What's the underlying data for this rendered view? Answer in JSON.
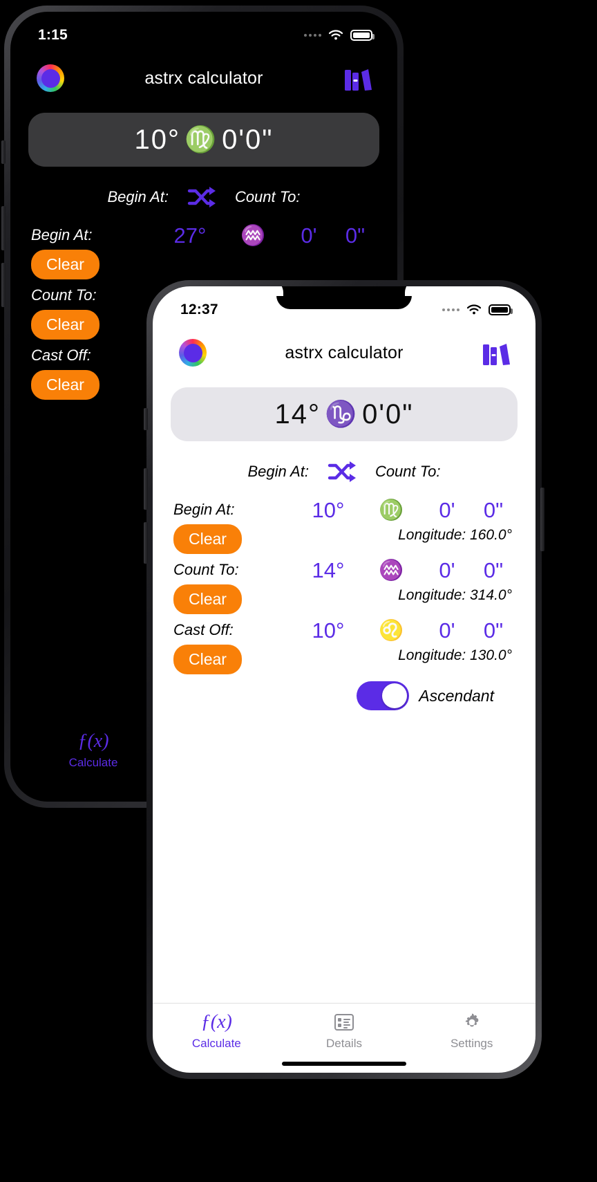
{
  "back_phone": {
    "status": {
      "time": "1:15",
      "wifi_icon": "wifi-icon",
      "battery_icon": "battery-icon",
      "signal_dots": "signal-dots-icon"
    },
    "header": {
      "logo_icon": "color-wheel-icon",
      "title": "astrx calculator",
      "library_icon": "books-icon"
    },
    "result": {
      "degrees": "10°",
      "sign_glyph": "♍",
      "sign_name": "Virgo",
      "minutes": "0'",
      "seconds": "0\""
    },
    "swap": {
      "left_label": "Begin At:",
      "icon": "shuffle-swap-icon",
      "right_label": "Count To:"
    },
    "rows": [
      {
        "label": "Begin At:",
        "clear_label": "Clear",
        "degrees": "27°",
        "sign_glyph": "♒",
        "sign_name": "Aquarius",
        "minutes": "0'",
        "seconds": "0\""
      },
      {
        "label": "Count To:",
        "clear_label": "Clear",
        "degrees": "",
        "sign_glyph": "",
        "sign_name": "",
        "minutes": "",
        "seconds": ""
      },
      {
        "label": "Cast Off:",
        "clear_label": "Clear",
        "degrees": "",
        "sign_glyph": "",
        "sign_name": "",
        "minutes": "",
        "seconds": ""
      }
    ],
    "tabs": [
      {
        "icon": "function-icon",
        "glyph": "ƒ(x)",
        "label": "Calculate",
        "active": true
      }
    ]
  },
  "front_phone": {
    "status": {
      "time": "12:37",
      "wifi_icon": "wifi-icon",
      "battery_icon": "battery-icon",
      "signal_dots": "signal-dots-icon"
    },
    "header": {
      "logo_icon": "color-wheel-icon",
      "title": "astrx calculator",
      "library_icon": "books-icon"
    },
    "result": {
      "degrees": "14°",
      "sign_glyph": "♑",
      "sign_name": "Capricorn",
      "minutes": "0'",
      "seconds": "0\""
    },
    "swap": {
      "left_label": "Begin At:",
      "icon": "shuffle-swap-icon",
      "right_label": "Count To:"
    },
    "rows": [
      {
        "label": "Begin At:",
        "clear_label": "Clear",
        "degrees": "10°",
        "sign_glyph": "♍",
        "sign_name": "Virgo",
        "minutes": "0'",
        "seconds": "0\"",
        "longitude": "Longitude: 160.0°"
      },
      {
        "label": "Count To:",
        "clear_label": "Clear",
        "degrees": "14°",
        "sign_glyph": "♒",
        "sign_name": "Aquarius",
        "minutes": "0'",
        "seconds": "0\"",
        "longitude": "Longitude: 314.0°"
      },
      {
        "label": "Cast Off:",
        "clear_label": "Clear",
        "degrees": "10°",
        "sign_glyph": "♌",
        "sign_name": "Leo",
        "minutes": "0'",
        "seconds": "0\"",
        "longitude": "Longitude: 130.0°"
      }
    ],
    "ascendant": {
      "label": "Ascendant",
      "state": "on"
    },
    "tabs": [
      {
        "icon": "function-icon",
        "glyph": "ƒ(x)",
        "label": "Calculate",
        "active": true
      },
      {
        "icon": "details-list-icon",
        "glyph": "",
        "label": "Details",
        "active": false
      },
      {
        "icon": "gear-icon",
        "glyph": "",
        "label": "Settings",
        "active": false
      }
    ]
  },
  "colors": {
    "accent_purple": "#5B2CE6",
    "clear_orange": "#F98008",
    "dark_bg": "#000000",
    "light_bg": "#FFFFFF",
    "result_pill_dark": "#3A3A3C",
    "result_pill_light": "#E6E5EA",
    "inactive_tab_gray": "#8E8E93"
  }
}
